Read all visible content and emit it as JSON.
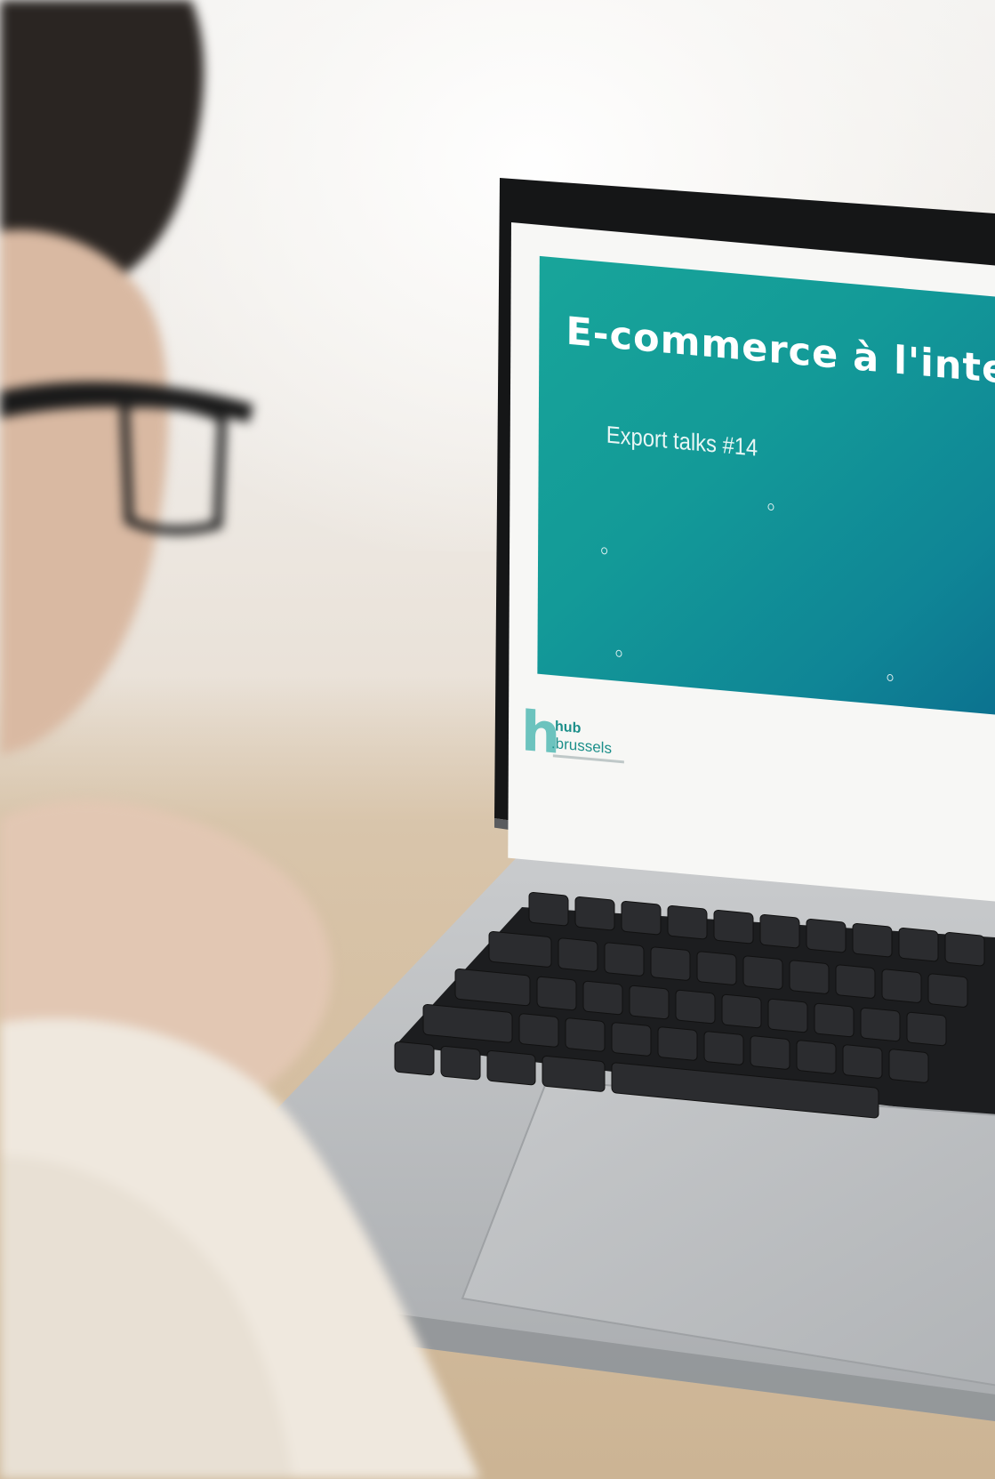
{
  "slide": {
    "title": "E-commerce à l'inter",
    "subtitle": "Export talks #14"
  },
  "logo": {
    "letter": "h",
    "line1": "hub",
    "line2": ".brussels"
  },
  "colors": {
    "slide_teal": "#139a98",
    "slide_blue": "#0b6e8e",
    "logo_teal": "#1c8f8a",
    "laptop_silver": "#b9bcbf",
    "bezel_black": "#151617",
    "desk_wood": "#d6c0a3"
  }
}
